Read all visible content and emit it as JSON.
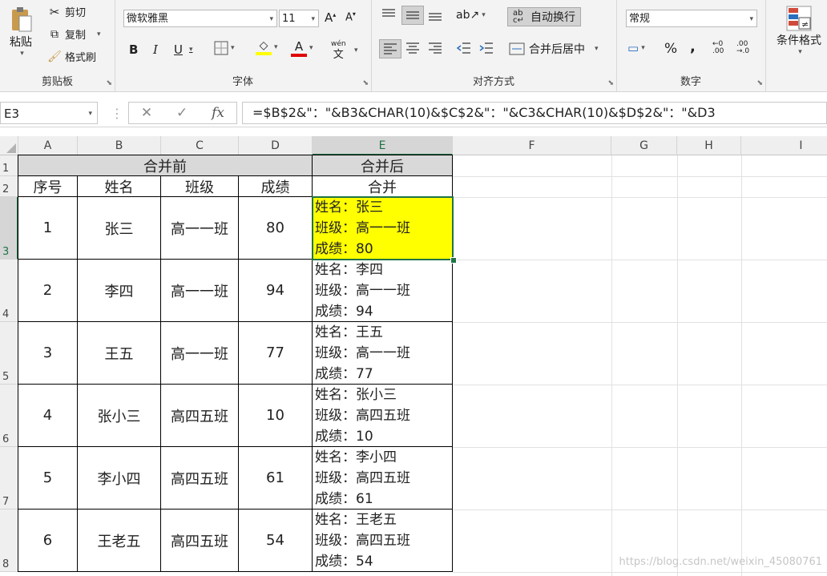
{
  "clipboard": {
    "paste": "粘贴",
    "cut": "剪切",
    "copy": "复制",
    "format_painter": "格式刷",
    "label": "剪贴板"
  },
  "font": {
    "name": "微软雅黑",
    "size": "11",
    "bold": "B",
    "italic": "I",
    "underline": "U",
    "phonetic": "wén",
    "label": "字体"
  },
  "alignment": {
    "wrap": "自动换行",
    "merge": "合并后居中",
    "label": "对齐方式"
  },
  "number": {
    "format": "常规",
    "percent": "%",
    "comma": ",",
    "label": "数字"
  },
  "styles": {
    "conditional": "条件格式"
  },
  "formula_bar": {
    "cell_ref": "E3",
    "formula": "=$B$2&\"：\"&B3&CHAR(10)&$C$2&\"：\"&C3&CHAR(10)&$D$2&\"：\"&D3"
  },
  "columns": [
    "A",
    "B",
    "C",
    "D",
    "E",
    "F",
    "G",
    "H",
    "I"
  ],
  "rows": [
    "1",
    "2",
    "3",
    "4",
    "5",
    "6",
    "7",
    "8"
  ],
  "header1": {
    "before": "合并前",
    "after": "合并后"
  },
  "header2": {
    "no": "序号",
    "name": "姓名",
    "class": "班级",
    "score": "成绩",
    "merged": "合并"
  },
  "data": [
    {
      "no": "1",
      "name": "张三",
      "class": "高一一班",
      "score": "80",
      "l1": "姓名：张三",
      "l2": "班级：高一一班",
      "l3": "成绩：80"
    },
    {
      "no": "2",
      "name": "李四",
      "class": "高一一班",
      "score": "94",
      "l1": "姓名：李四",
      "l2": "班级：高一一班",
      "l3": "成绩：94"
    },
    {
      "no": "3",
      "name": "王五",
      "class": "高一一班",
      "score": "77",
      "l1": "姓名：王五",
      "l2": "班级：高一一班",
      "l3": "成绩：77"
    },
    {
      "no": "4",
      "name": "张小三",
      "class": "高四五班",
      "score": "10",
      "l1": "姓名：张小三",
      "l2": "班级：高四五班",
      "l3": "成绩：10"
    },
    {
      "no": "5",
      "name": "李小四",
      "class": "高四五班",
      "score": "61",
      "l1": "姓名：李小四",
      "l2": "班级：高四五班",
      "l3": "成绩：61"
    },
    {
      "no": "6",
      "name": "王老五",
      "class": "高四五班",
      "score": "54",
      "l1": "姓名：王老五",
      "l2": "班级：高四五班",
      "l3": "成绩：54"
    }
  ],
  "colors": {
    "selected_fill": "#ffff00",
    "header_fill": "#d9d9d9",
    "accent": "#217346"
  },
  "watermark": "https://blog.csdn.net/weixin_45080761"
}
